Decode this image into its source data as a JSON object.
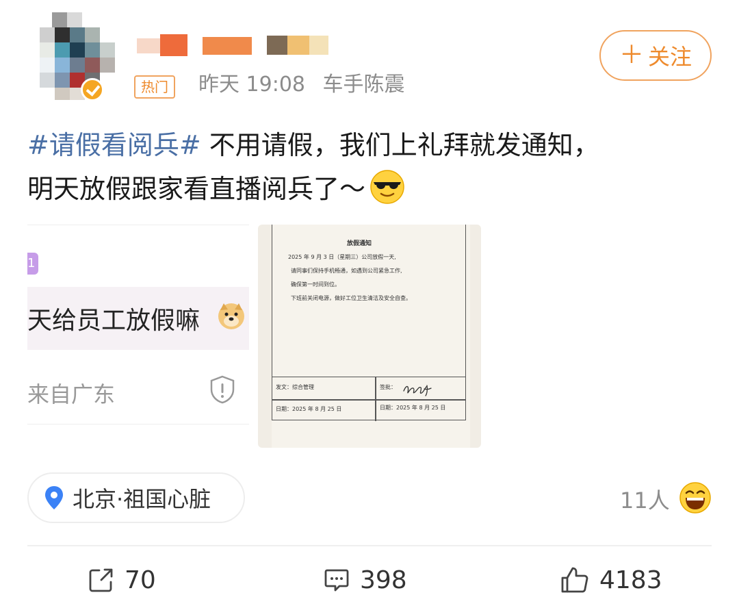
{
  "header": {
    "hot_badge": "热门",
    "time": "昨天 19:08",
    "device": "车手陈震",
    "follow_label": "关注",
    "follow_plus": "＋"
  },
  "post": {
    "hashtag": "#请假看阅兵#",
    "text_line1": " 不用请假，我们上礼拜就发通知，",
    "text_line2": "明天放假跟家看直播阅兵了～"
  },
  "left_image": {
    "tag": "1",
    "main_text": "天给员工放假嘛",
    "location_text": "来自广东"
  },
  "document": {
    "title": "放假通知",
    "line1": "2025 年 9 月 3 日（星期三）公司放假一天,",
    "line2": "请同事们保持手机畅通，如遇到公司紧急工作,",
    "line3": "确保第一时间到位。",
    "line4": "下班前关闭电源，做好工位卫生清洁及安全自查。",
    "issuer_label": "发文：综合管理",
    "approve_label": "签批：",
    "date_left": "日期：2025 年 8 月 25 日",
    "date_right": "日期：2025 年 8 月 25 日"
  },
  "location_chip": {
    "label": "北京·祖国心脏"
  },
  "reactions": {
    "people_count": "11人"
  },
  "actions": {
    "share_count": "70",
    "comment_count": "398",
    "like_count": "4183"
  },
  "colors": {
    "accent_orange": "#ee8a2c",
    "hashtag_blue": "#4a6fa5",
    "location_pin_blue": "#3b82f6",
    "muted_gray": "#8c8c8c"
  },
  "icons": {
    "share": "share-icon",
    "comment": "comment-icon",
    "like": "thumbs-up-icon",
    "pin": "location-pin-icon",
    "verified": "verified-badge-icon"
  }
}
